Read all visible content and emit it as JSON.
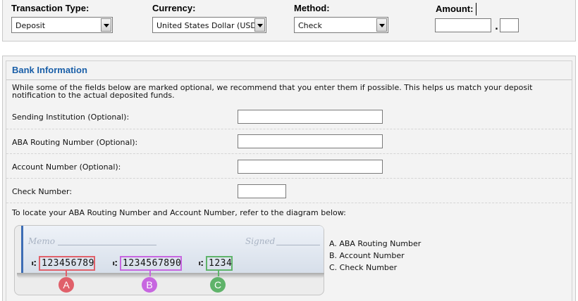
{
  "transaction": {
    "type_label": "Transaction Type:",
    "type_value": "Deposit",
    "currency_label": "Currency:",
    "currency_value": "United States Dollar (USD)",
    "method_label": "Method:",
    "method_value": "Check",
    "amount_label": "Amount:",
    "amount_separator": ".",
    "amount_whole": "",
    "amount_cents": ""
  },
  "bank": {
    "title": "Bank Information",
    "intro": "While some of the fields below are marked optional, we recommend that you enter them if possible. This helps us match your deposit notification to the actual deposited funds.",
    "fields": [
      {
        "label": "Sending Institution (Optional):",
        "value": ""
      },
      {
        "label": "ABA Routing Number (Optional):",
        "value": ""
      },
      {
        "label": "Account Number (Optional):",
        "value": ""
      },
      {
        "label": "Check Number:",
        "value": ""
      }
    ],
    "diagram_hint": "To locate your ABA Routing Number and Account Number, refer to the diagram below:"
  },
  "diagram": {
    "memo_text": "Memo",
    "signed_text": "Signed",
    "micr_symbol": "⑆",
    "routing_number": "123456789",
    "account_number": "1234567890",
    "check_number": "1234",
    "badges": [
      "A",
      "B",
      "C"
    ],
    "legend": [
      "A. ABA Routing Number",
      "B. Account Number",
      "C. Check Number"
    ],
    "colors": {
      "routing": "#e0606a",
      "account": "#c766e0",
      "check": "#5fb36a",
      "accent": "#1a5fa8"
    }
  }
}
